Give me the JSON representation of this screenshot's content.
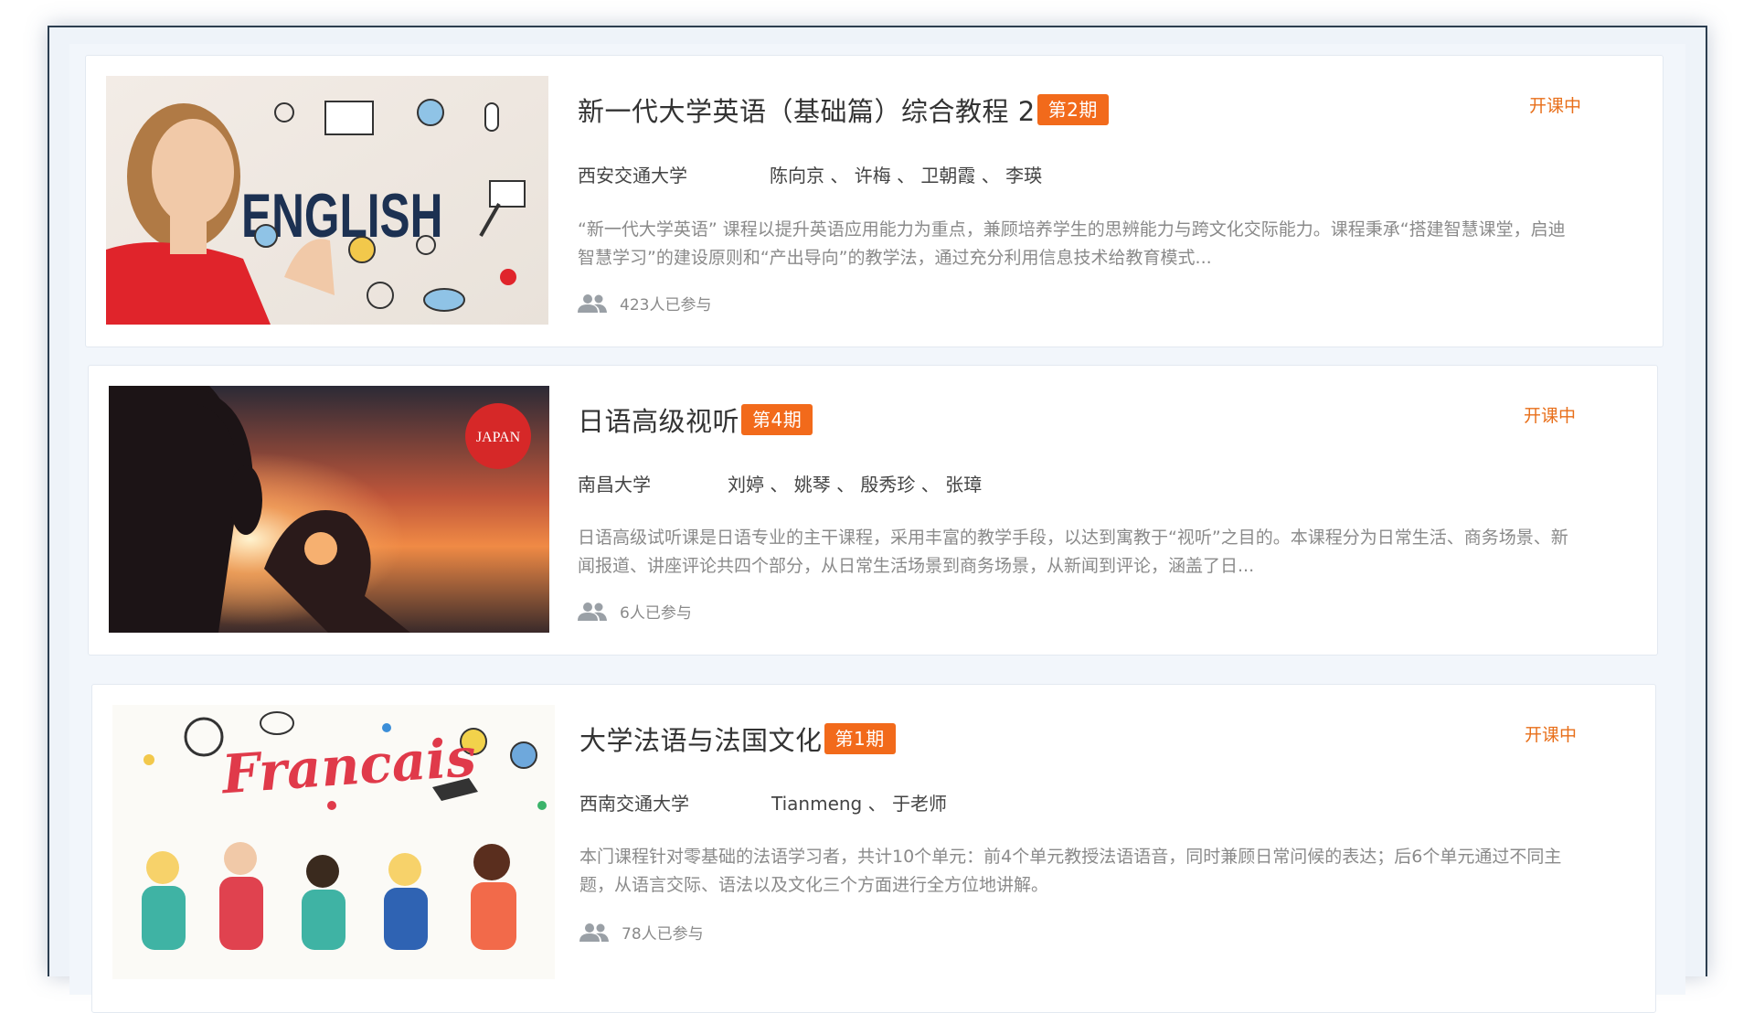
{
  "courses": [
    {
      "title": "新一代大学英语（基础篇）综合教程 2",
      "term": "第2期",
      "status": "开课中",
      "school": "西安交通大学",
      "teachers": "陈向京 、 许梅 、 卫朝霞 、 李瑛",
      "description": "“新一代大学英语” 课程以提升英语应用能力为重点，兼顾培养学生的思辨能力与跨文化交际能力。课程秉承“搭建智慧课堂，启迪智慧学习”的建设原则和“产出导向”的教学法，通过充分利用信息技术给教育模式...",
      "participants": "423人已参与",
      "thumbnail_text": "ENGLISH"
    },
    {
      "title": "日语高级视听",
      "term": "第4期",
      "status": "开课中",
      "school": "南昌大学",
      "teachers": "刘婷 、 姚琴 、 殷秀珍 、 张璋",
      "description": "日语高级试听课是日语专业的主干课程，采用丰富的教学手段，以达到寓教于“视听”之目的。本课程分为日常生活、商务场景、新闻报道、讲座评论共四个部分，从日常生活场景到商务场景，从新闻到评论，涵盖了日...",
      "participants": "6人已参与",
      "thumbnail_text": "JAPAN"
    },
    {
      "title": "大学法语与法国文化",
      "term": "第1期",
      "status": "开课中",
      "school": "西南交通大学",
      "teachers": "Tianmeng 、 于老师",
      "description": "本门课程针对零基础的法语学习者，共计10个单元：前4个单元教授法语语音，同时兼顾日常问候的表达；后6个单元通过不同主题，从语言交际、语法以及文化三个方面进行全方位地讲解。",
      "participants": "78人已参与",
      "thumbnail_text": "Francais"
    }
  ],
  "colors": {
    "accent": "#f26a1b",
    "status": "#e86f1a",
    "frame_border": "#2c3e50"
  },
  "icons": {
    "participants": "people-icon"
  }
}
